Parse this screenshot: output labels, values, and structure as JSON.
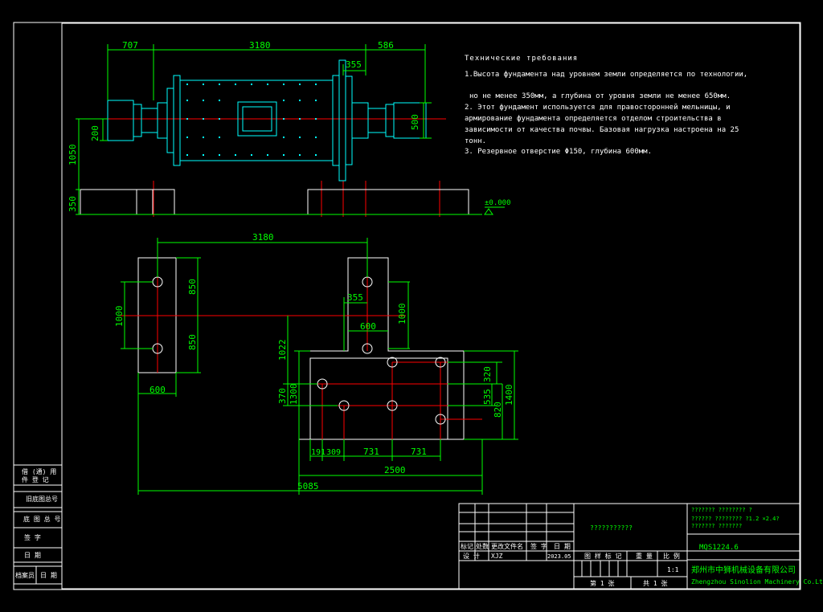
{
  "colors": {
    "bg": "#000000",
    "line": "#ffffff",
    "dim": "#00ff00",
    "center": "#ff0000",
    "mill": "#00ffff"
  },
  "top_dims": {
    "d707": "707",
    "d3180": "3180",
    "d586": "586",
    "d355": "355",
    "d500": "500",
    "d200": "200",
    "d1050": "1050",
    "d350": "350",
    "level": "±0.000"
  },
  "plan_dims": {
    "d3180": "3180",
    "d1000a": "1000",
    "d850a": "850",
    "d850b": "850",
    "d355": "355",
    "d1000b": "1000",
    "d600a": "600",
    "d1022": "1022",
    "d600b": "600",
    "d370": "370",
    "d1300": "1300",
    "d320": "320",
    "d535": "535",
    "d820": "820",
    "d1400": "1400",
    "d191": "191",
    "d309": "309",
    "d731a": "731",
    "d731b": "731",
    "d2500": "2500",
    "d5085": "5085"
  },
  "notes": {
    "title": "Технические требования",
    "line1": "1.Высота фундамента над уровнем земли определяется по технологии,",
    "line2": "но не менее 350мм, а глубина от уровня земли не менее 650мм.",
    "line3": "2. Этот фундамент используется для правосторонней мельницы, и",
    "line4": "армирование    фундамента определяется отделом строительства в",
    "line5": "зависимости от качества почвы. Базовая нагрузка настроена на 25",
    "line6": "тонн.",
    "line7": "3. Резервное отверстие Φ150, глубина 600мм."
  },
  "sidebar": {
    "r1a": "借 (通) 用",
    "r1b": "件 登 记",
    "r2": "旧底图总号",
    "r3": "底 图 总 号",
    "r4": "签    字",
    "r5": "日    期",
    "r6a": "档案员",
    "r6b": "日  期"
  },
  "titleblock": {
    "drawing_name": "???????????",
    "spec1": "??????? ???????? ?",
    "spec2": "?????? ???????? ?1.2 ×2.4?",
    "spec3": "??????? ???????",
    "h_mark": "标记",
    "h_count": "处数",
    "h_file": "更改文件名",
    "h_sign": "签 字",
    "h_date": "日 期",
    "design_label": "设  计",
    "designer": "XJZ",
    "design_date": "2023.05",
    "stage": "图 样 标 记",
    "weight": "重 量",
    "scale_label": "比  例",
    "scale": "1:1",
    "sheet": "第  1  张",
    "total": "共  1  张",
    "code": "MQS1224.6",
    "company_cn": "郑州市中狮机械设备有限公司",
    "company_en": "Zhengzhou Sinolion Machinery Co.Ltd"
  }
}
